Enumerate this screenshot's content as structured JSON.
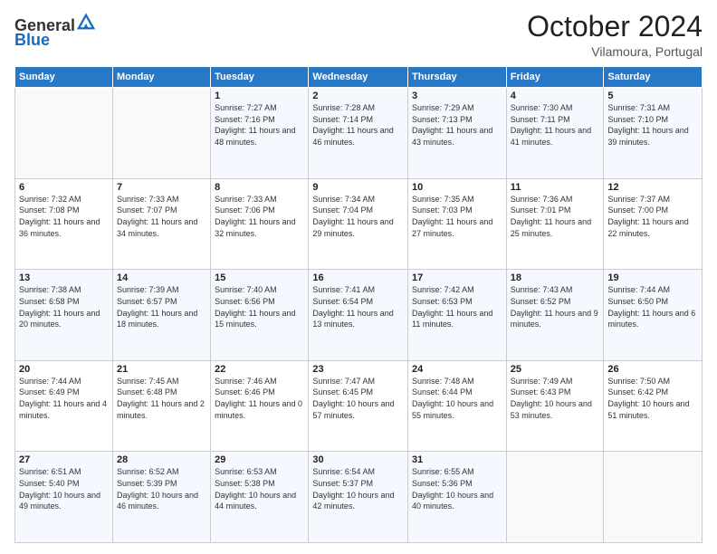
{
  "header": {
    "logo_general": "General",
    "logo_blue": "Blue",
    "month": "October 2024",
    "location": "Vilamoura, Portugal"
  },
  "days_of_week": [
    "Sunday",
    "Monday",
    "Tuesday",
    "Wednesday",
    "Thursday",
    "Friday",
    "Saturday"
  ],
  "weeks": [
    [
      {
        "day": "",
        "sunrise": "",
        "sunset": "",
        "daylight": ""
      },
      {
        "day": "",
        "sunrise": "",
        "sunset": "",
        "daylight": ""
      },
      {
        "day": "1",
        "sunrise": "Sunrise: 7:27 AM",
        "sunset": "Sunset: 7:16 PM",
        "daylight": "Daylight: 11 hours and 48 minutes."
      },
      {
        "day": "2",
        "sunrise": "Sunrise: 7:28 AM",
        "sunset": "Sunset: 7:14 PM",
        "daylight": "Daylight: 11 hours and 46 minutes."
      },
      {
        "day": "3",
        "sunrise": "Sunrise: 7:29 AM",
        "sunset": "Sunset: 7:13 PM",
        "daylight": "Daylight: 11 hours and 43 minutes."
      },
      {
        "day": "4",
        "sunrise": "Sunrise: 7:30 AM",
        "sunset": "Sunset: 7:11 PM",
        "daylight": "Daylight: 11 hours and 41 minutes."
      },
      {
        "day": "5",
        "sunrise": "Sunrise: 7:31 AM",
        "sunset": "Sunset: 7:10 PM",
        "daylight": "Daylight: 11 hours and 39 minutes."
      }
    ],
    [
      {
        "day": "6",
        "sunrise": "Sunrise: 7:32 AM",
        "sunset": "Sunset: 7:08 PM",
        "daylight": "Daylight: 11 hours and 36 minutes."
      },
      {
        "day": "7",
        "sunrise": "Sunrise: 7:33 AM",
        "sunset": "Sunset: 7:07 PM",
        "daylight": "Daylight: 11 hours and 34 minutes."
      },
      {
        "day": "8",
        "sunrise": "Sunrise: 7:33 AM",
        "sunset": "Sunset: 7:06 PM",
        "daylight": "Daylight: 11 hours and 32 minutes."
      },
      {
        "day": "9",
        "sunrise": "Sunrise: 7:34 AM",
        "sunset": "Sunset: 7:04 PM",
        "daylight": "Daylight: 11 hours and 29 minutes."
      },
      {
        "day": "10",
        "sunrise": "Sunrise: 7:35 AM",
        "sunset": "Sunset: 7:03 PM",
        "daylight": "Daylight: 11 hours and 27 minutes."
      },
      {
        "day": "11",
        "sunrise": "Sunrise: 7:36 AM",
        "sunset": "Sunset: 7:01 PM",
        "daylight": "Daylight: 11 hours and 25 minutes."
      },
      {
        "day": "12",
        "sunrise": "Sunrise: 7:37 AM",
        "sunset": "Sunset: 7:00 PM",
        "daylight": "Daylight: 11 hours and 22 minutes."
      }
    ],
    [
      {
        "day": "13",
        "sunrise": "Sunrise: 7:38 AM",
        "sunset": "Sunset: 6:58 PM",
        "daylight": "Daylight: 11 hours and 20 minutes."
      },
      {
        "day": "14",
        "sunrise": "Sunrise: 7:39 AM",
        "sunset": "Sunset: 6:57 PM",
        "daylight": "Daylight: 11 hours and 18 minutes."
      },
      {
        "day": "15",
        "sunrise": "Sunrise: 7:40 AM",
        "sunset": "Sunset: 6:56 PM",
        "daylight": "Daylight: 11 hours and 15 minutes."
      },
      {
        "day": "16",
        "sunrise": "Sunrise: 7:41 AM",
        "sunset": "Sunset: 6:54 PM",
        "daylight": "Daylight: 11 hours and 13 minutes."
      },
      {
        "day": "17",
        "sunrise": "Sunrise: 7:42 AM",
        "sunset": "Sunset: 6:53 PM",
        "daylight": "Daylight: 11 hours and 11 minutes."
      },
      {
        "day": "18",
        "sunrise": "Sunrise: 7:43 AM",
        "sunset": "Sunset: 6:52 PM",
        "daylight": "Daylight: 11 hours and 9 minutes."
      },
      {
        "day": "19",
        "sunrise": "Sunrise: 7:44 AM",
        "sunset": "Sunset: 6:50 PM",
        "daylight": "Daylight: 11 hours and 6 minutes."
      }
    ],
    [
      {
        "day": "20",
        "sunrise": "Sunrise: 7:44 AM",
        "sunset": "Sunset: 6:49 PM",
        "daylight": "Daylight: 11 hours and 4 minutes."
      },
      {
        "day": "21",
        "sunrise": "Sunrise: 7:45 AM",
        "sunset": "Sunset: 6:48 PM",
        "daylight": "Daylight: 11 hours and 2 minutes."
      },
      {
        "day": "22",
        "sunrise": "Sunrise: 7:46 AM",
        "sunset": "Sunset: 6:46 PM",
        "daylight": "Daylight: 11 hours and 0 minutes."
      },
      {
        "day": "23",
        "sunrise": "Sunrise: 7:47 AM",
        "sunset": "Sunset: 6:45 PM",
        "daylight": "Daylight: 10 hours and 57 minutes."
      },
      {
        "day": "24",
        "sunrise": "Sunrise: 7:48 AM",
        "sunset": "Sunset: 6:44 PM",
        "daylight": "Daylight: 10 hours and 55 minutes."
      },
      {
        "day": "25",
        "sunrise": "Sunrise: 7:49 AM",
        "sunset": "Sunset: 6:43 PM",
        "daylight": "Daylight: 10 hours and 53 minutes."
      },
      {
        "day": "26",
        "sunrise": "Sunrise: 7:50 AM",
        "sunset": "Sunset: 6:42 PM",
        "daylight": "Daylight: 10 hours and 51 minutes."
      }
    ],
    [
      {
        "day": "27",
        "sunrise": "Sunrise: 6:51 AM",
        "sunset": "Sunset: 5:40 PM",
        "daylight": "Daylight: 10 hours and 49 minutes."
      },
      {
        "day": "28",
        "sunrise": "Sunrise: 6:52 AM",
        "sunset": "Sunset: 5:39 PM",
        "daylight": "Daylight: 10 hours and 46 minutes."
      },
      {
        "day": "29",
        "sunrise": "Sunrise: 6:53 AM",
        "sunset": "Sunset: 5:38 PM",
        "daylight": "Daylight: 10 hours and 44 minutes."
      },
      {
        "day": "30",
        "sunrise": "Sunrise: 6:54 AM",
        "sunset": "Sunset: 5:37 PM",
        "daylight": "Daylight: 10 hours and 42 minutes."
      },
      {
        "day": "31",
        "sunrise": "Sunrise: 6:55 AM",
        "sunset": "Sunset: 5:36 PM",
        "daylight": "Daylight: 10 hours and 40 minutes."
      },
      {
        "day": "",
        "sunrise": "",
        "sunset": "",
        "daylight": ""
      },
      {
        "day": "",
        "sunrise": "",
        "sunset": "",
        "daylight": ""
      }
    ]
  ]
}
